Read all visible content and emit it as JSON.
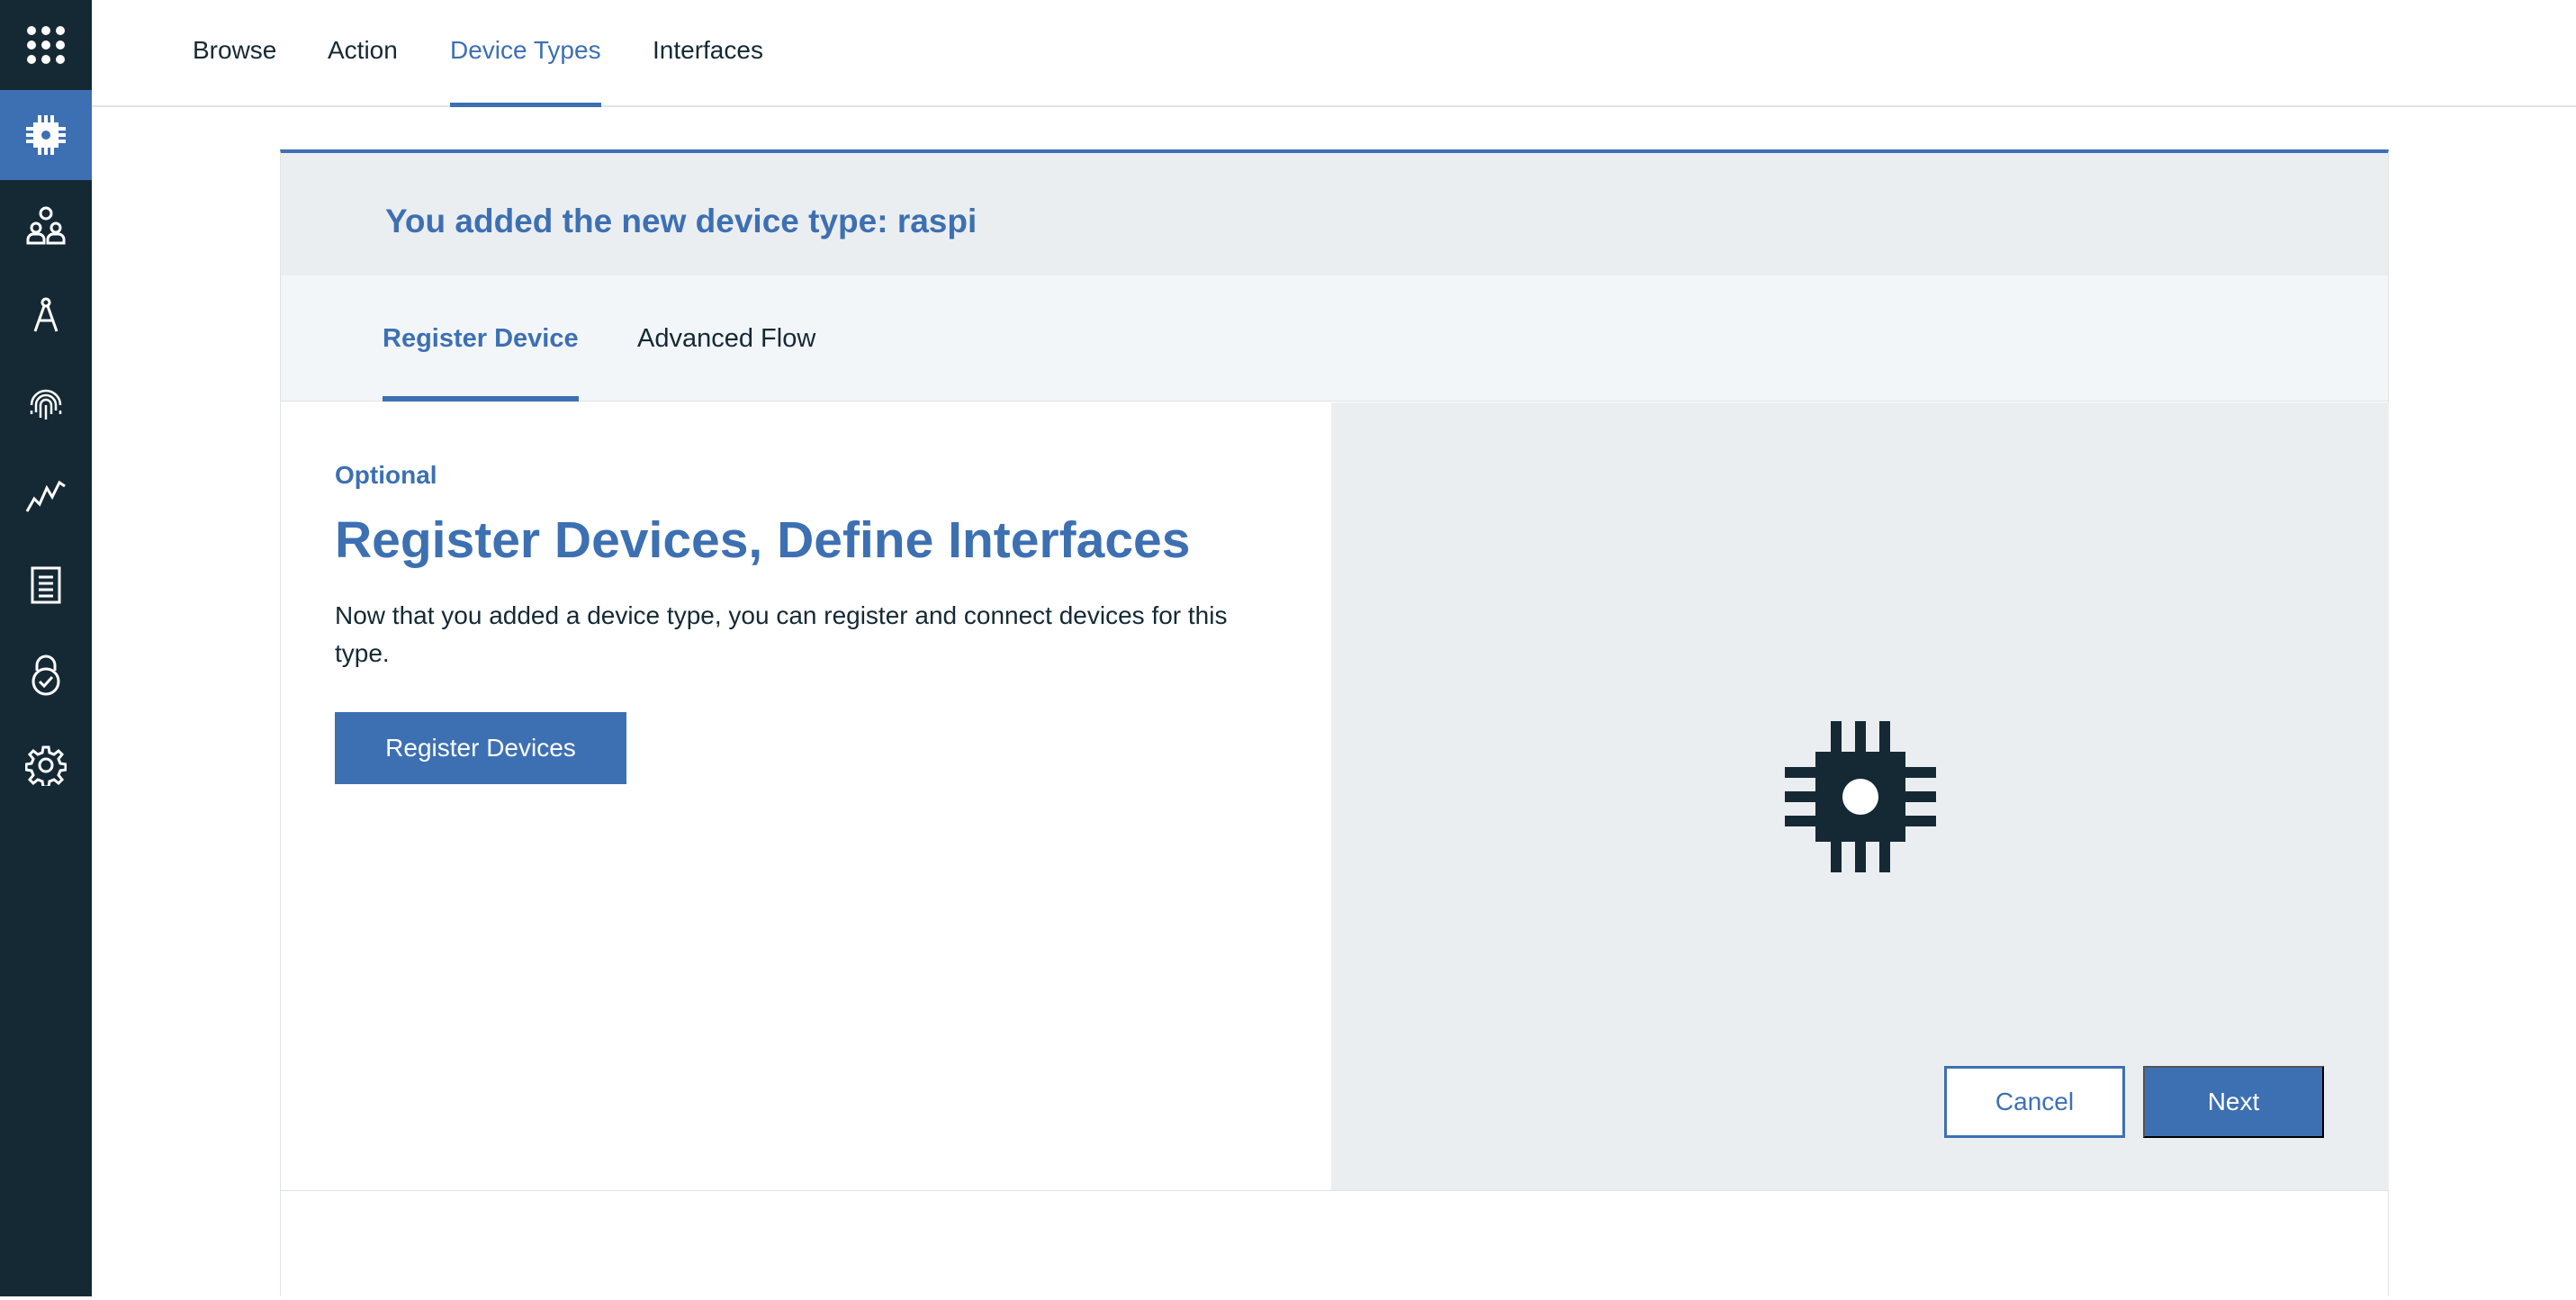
{
  "sidebar": {
    "items": [
      {
        "icon": "app-switcher-icon"
      },
      {
        "icon": "chip-icon",
        "active": true
      },
      {
        "icon": "members-icon"
      },
      {
        "icon": "compass-icon"
      },
      {
        "icon": "fingerprint-icon"
      },
      {
        "icon": "analytics-icon"
      },
      {
        "icon": "document-icon"
      },
      {
        "icon": "security-lock-icon"
      },
      {
        "icon": "settings-gear-icon"
      }
    ]
  },
  "topnav": {
    "tabs": [
      {
        "label": "Browse"
      },
      {
        "label": "Action"
      },
      {
        "label": "Device Types",
        "active": true
      },
      {
        "label": "Interfaces"
      }
    ]
  },
  "card": {
    "title_prefix": "You added the new device type: ",
    "device_type": "raspi",
    "subtabs": [
      {
        "label": "Register Device",
        "active": true
      },
      {
        "label": "Advanced Flow"
      }
    ],
    "eyebrow": "Optional",
    "headline": "Register Devices, Define Interfaces",
    "description": "Now that you added a device type, you can register and connect devices for this type.",
    "register_button": "Register Devices",
    "illustration_icon": "chip-icon"
  },
  "footer": {
    "cancel": "Cancel",
    "next": "Next"
  },
  "colors": {
    "accent": "#3d70b2",
    "sidebar_bg": "#152935",
    "header_bg": "#ebeef1",
    "text": "#152935"
  }
}
